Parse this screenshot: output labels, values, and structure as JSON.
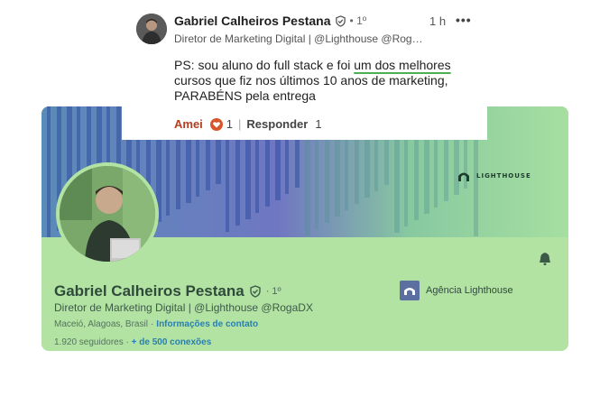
{
  "comment": {
    "author": "Gabriel Calheiros Pestana",
    "degree": "• 1º",
    "time": "1 h",
    "more": "•••",
    "headline": "Diretor de Marketing Digital | @Lighthouse @Rog…",
    "text_before": "PS: sou aluno do full stack e foi ",
    "text_highlight": "um dos melhores",
    "text_after": " cursos que fiz nos últimos 10 anos de marketing, PARABÉNS pela entrega",
    "like_label": "Amei",
    "reaction_count": "1",
    "separator": "|",
    "reply_label": "Responder",
    "reply_count": "1"
  },
  "profile": {
    "name": "Gabriel Calheiros Pestana",
    "degree": "· 1º",
    "headline": "Diretor de Marketing Digital | @Lighthouse @RogaDX",
    "location": "Maceió, Alagoas, Brasil",
    "location_sep": "·",
    "contact_link": "Informações de contato",
    "followers": "1.920 seguidores",
    "stats_sep": " · ",
    "connections": "+ de 500 conexões",
    "company": "Agência Lighthouse",
    "banner_brand": "LIGHTHOUSE"
  },
  "colors": {
    "card_bg": "#b2e3a3",
    "link": "#2a7fae",
    "love_reaction": "#d9552c",
    "underline_highlight": "#4caf50"
  },
  "icons": [
    "verified-icon",
    "more-icon",
    "heart-reaction-icon",
    "bell-icon",
    "lighthouse-logo-icon",
    "company-logo-icon"
  ]
}
